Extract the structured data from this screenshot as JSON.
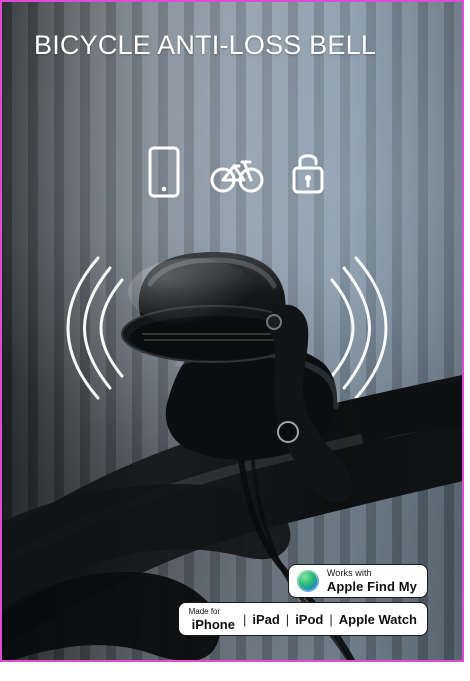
{
  "title": "BICYCLE ANTI-LOSS BELL",
  "icons": [
    "phone-icon",
    "bicycle-icon",
    "padlock-icon"
  ],
  "badges": {
    "findmy": {
      "small": "Works with",
      "big": "Apple Find My"
    },
    "made_for": {
      "made_for": "Made for",
      "items": [
        "iPhone",
        "iPad",
        "iPod",
        "Apple Watch"
      ],
      "separator": "|"
    }
  },
  "colors": {
    "frame_border": "#e04ad8",
    "title": "#ffffff",
    "badge_bg": "#ffffff",
    "badge_text": "#111111"
  }
}
